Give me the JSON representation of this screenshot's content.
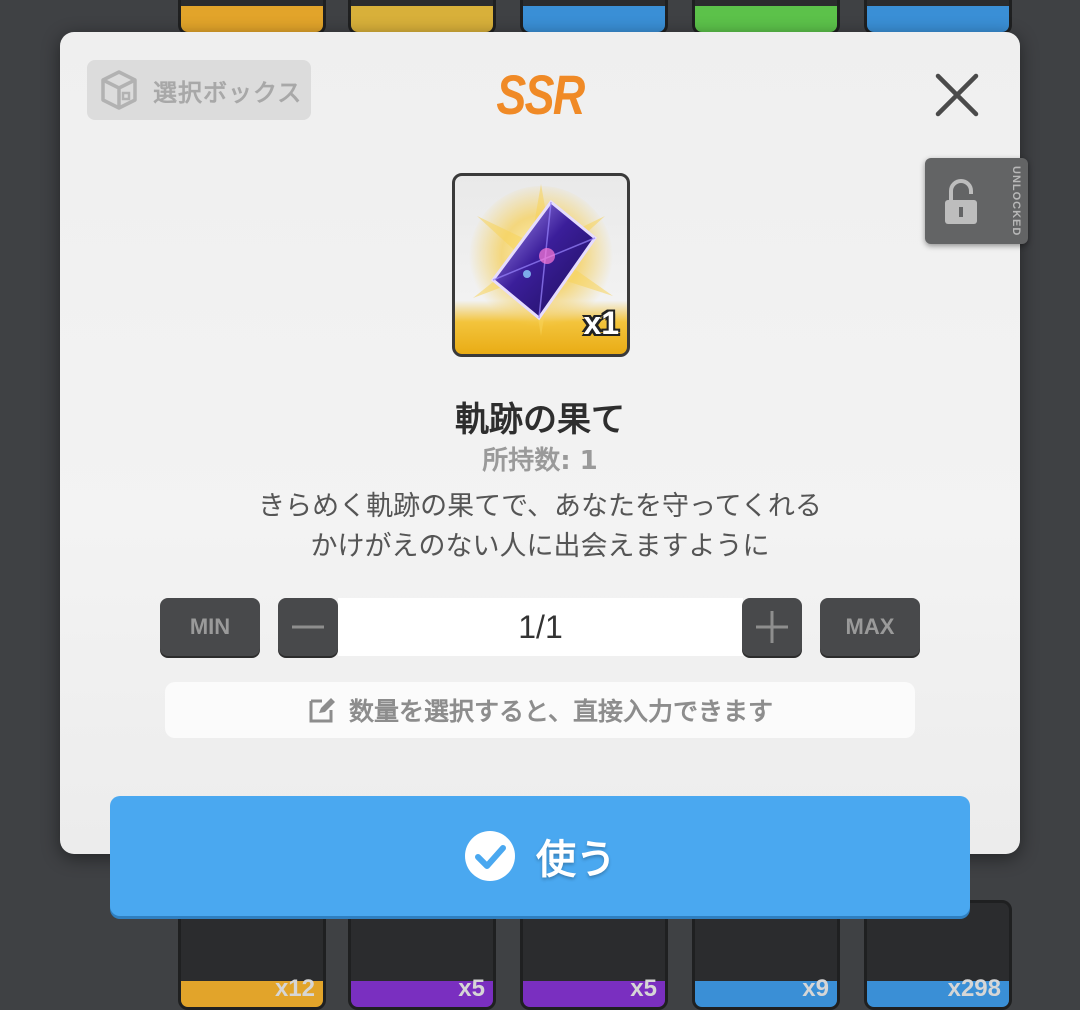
{
  "background": {
    "bottom_tiles": [
      {
        "count": "x12",
        "strip_color": "#e2a42a"
      },
      {
        "count": "x5",
        "strip_color": "#7a2fc0"
      },
      {
        "count": "x5",
        "strip_color": "#7a2fc0"
      },
      {
        "count": "x9",
        "strip_color": "#3a8fd6"
      },
      {
        "count": "x298",
        "strip_color": "#3a8fd6"
      }
    ]
  },
  "modal": {
    "select_box_label": "選択ボックス",
    "rarity": "SSR",
    "item": {
      "icon": "crystal-diamond-icon",
      "quantity_badge": "x1",
      "name": "軌跡の果て",
      "owned": "所持数: 1",
      "description_lines": [
        "きらめく軌跡の果てで、あなたを守ってくれる",
        "かけがえのない人に出会えますように"
      ]
    },
    "quantity": {
      "min_label": "MIN",
      "max_label": "MAX",
      "value": "1/1"
    },
    "hint": "数量を選択すると、直接入力できます",
    "lock_tab_label": "UNLOCKED",
    "use_button_label": "使う"
  },
  "colors": {
    "rarity": "#f08a26",
    "use_button": "#4aa8f0",
    "qty_buttons": "#48494b"
  }
}
